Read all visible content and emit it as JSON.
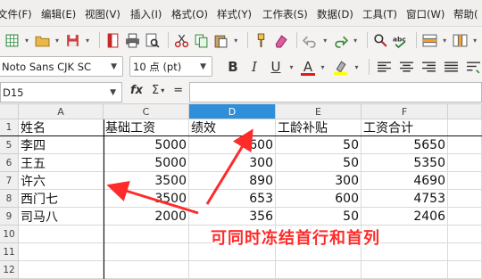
{
  "menu": [
    "文件(F)",
    "编辑(E)",
    "视图(V)",
    "插入(I)",
    "格式(O)",
    "样式(Y)",
    "工作表(S)",
    "数据(D)",
    "工具(T)",
    "窗口(W)",
    "帮助("
  ],
  "toolbar": {
    "font_name": "Noto Sans CJK SC",
    "font_size": "10 点 (pt)",
    "bold_label": "B",
    "italic_label": "I",
    "underline_label": "U",
    "font_color_label": "A",
    "font_color": "#e01b1b",
    "highlight_color": "#ffff00"
  },
  "formula_bar": {
    "cell_ref": "D15",
    "fx_label": "fx",
    "sum_label": "Σ",
    "equals_label": "=",
    "formula": ""
  },
  "sheet": {
    "columns": [
      "A",
      "C",
      "D",
      "E",
      "F"
    ],
    "selected_column": "D",
    "rows": [
      {
        "num": "1",
        "cells": [
          "姓名",
          "基础工资",
          "绩效",
          "工龄补贴",
          "工资合计"
        ],
        "header": true
      },
      {
        "num": "5",
        "cells": [
          "李四",
          "5000",
          "600",
          "50",
          "5650"
        ]
      },
      {
        "num": "6",
        "cells": [
          "王五",
          "5000",
          "300",
          "50",
          "5350"
        ]
      },
      {
        "num": "7",
        "cells": [
          "许六",
          "3500",
          "890",
          "300",
          "4690"
        ]
      },
      {
        "num": "8",
        "cells": [
          "西门七",
          "3500",
          "653",
          "600",
          "4753"
        ]
      },
      {
        "num": "9",
        "cells": [
          "司马八",
          "2000",
          "356",
          "50",
          "2406"
        ]
      },
      {
        "num": "10",
        "cells": [
          "",
          "",
          "",
          "",
          ""
        ]
      },
      {
        "num": "11",
        "cells": [
          "",
          "",
          "",
          "",
          ""
        ]
      },
      {
        "num": "12",
        "cells": [
          "",
          "",
          "",
          "",
          ""
        ]
      }
    ]
  },
  "annotation": {
    "text": "可同时冻结首行和首列",
    "color": "#ff2a2a"
  }
}
